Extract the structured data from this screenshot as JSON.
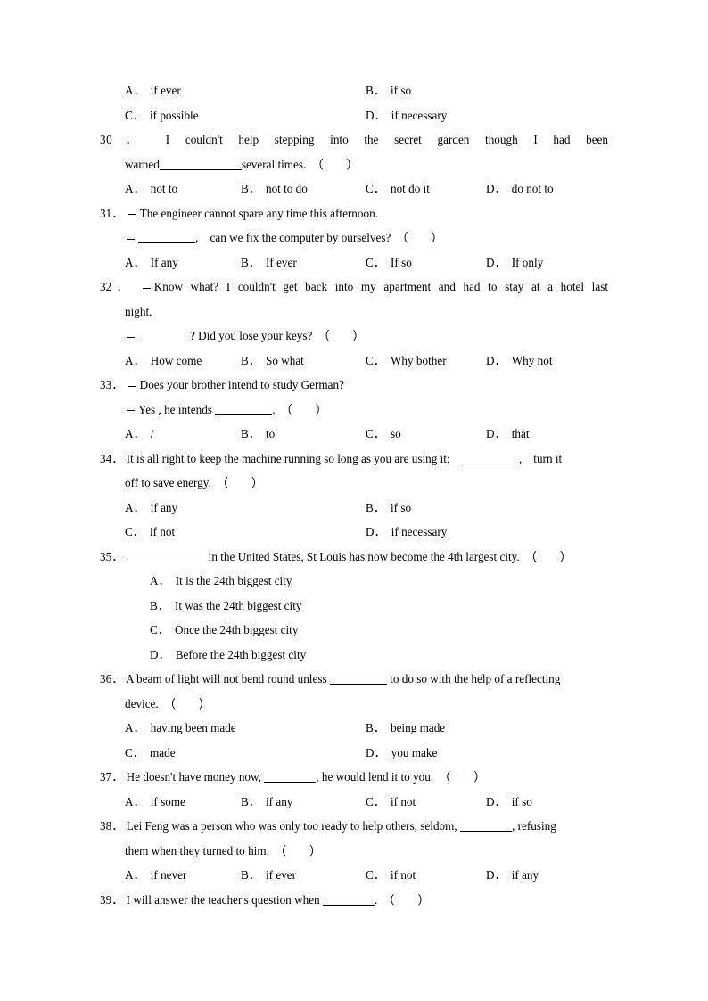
{
  "document": {
    "type": "english-grammar-worksheet",
    "punctuation": {
      "option_separator": "．",
      "paren_open": "（",
      "paren_close": "）",
      "dash": "－"
    }
  },
  "q29_options": {
    "a_label": "A",
    "a_text": "if ever",
    "b_label": "B",
    "b_text": "if so",
    "c_label": "C",
    "c_text": "if possible",
    "d_label": "D",
    "d_text": "if necessary"
  },
  "q30": {
    "number": "30",
    "stem_line1": "I couldn't help stepping into the secret garden though I had been",
    "stem_line2_pre": "warned",
    "stem_line2_post": "several times.",
    "options": {
      "a_label": "A",
      "a_text": "not to",
      "b_label": "B",
      "b_text": "not to do",
      "c_label": "C",
      "c_text": "not do it",
      "d_label": "D",
      "d_text": "do not to"
    }
  },
  "q31": {
    "number": "31",
    "line1": "The engineer cannot spare any time this afternoon.",
    "line2_post": ",　can we fix the computer by ourselves?",
    "options": {
      "a_label": "A",
      "a_text": "If any",
      "b_label": "B",
      "b_text": "If ever",
      "c_label": "C",
      "c_text": "If so",
      "d_label": "D",
      "d_text": "If only"
    }
  },
  "q32": {
    "number": "32",
    "line1": "Know what?  I couldn't get back into my apartment and had to stay at a hotel last",
    "line1_cont": "night.",
    "line2_post": "?  Did you lose your keys?",
    "options": {
      "a_label": "A",
      "a_text": "How come",
      "b_label": "B",
      "b_text": "So what",
      "c_label": "C",
      "c_text": "Why bother",
      "d_label": "D",
      "d_text": "Why not"
    }
  },
  "q33": {
    "number": "33",
    "line1": "Does your brother intend to study German?",
    "line2_pre": "Yes , he intends",
    "line2_post": ".",
    "options": {
      "a_label": "A",
      "a_text": "/",
      "b_label": "B",
      "b_text": "to",
      "c_label": "C",
      "c_text": "so",
      "d_label": "D",
      "d_text": "that"
    }
  },
  "q34": {
    "number": "34",
    "stem_line1": "It is all right to keep the machine running so long as you are using it;",
    "stem_line1_post": ",　turn it",
    "stem_line2": "off to save energy.",
    "options": {
      "a_label": "A",
      "a_text": "if any",
      "b_label": "B",
      "b_text": "if so",
      "c_label": "C",
      "c_text": "if not",
      "d_label": "D",
      "d_text": "if necessary"
    }
  },
  "q35": {
    "number": "35",
    "stem_post": "in the United States, St Louis has now become the 4th largest city.",
    "options": {
      "a_label": "A",
      "a_text": "It is the 24th biggest city",
      "b_label": "B",
      "b_text": "It was the 24th biggest city",
      "c_label": "C",
      "c_text": "Once the 24th biggest city",
      "d_label": "D",
      "d_text": "Before the 24th biggest city"
    }
  },
  "q36": {
    "number": "36",
    "stem_pre": "A beam of light will not bend round unless",
    "stem_post": "to do so with the help of a reflecting",
    "stem_line2": "device.",
    "options": {
      "a_label": "A",
      "a_text": "having been made",
      "b_label": "B",
      "b_text": "being made",
      "c_label": "C",
      "c_text": "made",
      "d_label": "D",
      "d_text": "you make"
    }
  },
  "q37": {
    "number": "37",
    "stem_pre": "He doesn't have money now,",
    "stem_post": ", he would lend it to you.",
    "options": {
      "a_label": "A",
      "a_text": "if some",
      "b_label": "B",
      "b_text": "if any",
      "c_label": "C",
      "c_text": "if not",
      "d_label": "D",
      "d_text": "if so"
    }
  },
  "q38": {
    "number": "38",
    "stem_pre": "Lei Feng was a person who was only too ready to help others, seldom,",
    "stem_post": ", refusing",
    "stem_line2": "them when they turned to him.",
    "options": {
      "a_label": "A",
      "a_text": "if never",
      "b_label": "B",
      "b_text": "if ever",
      "c_label": "C",
      "c_text": "if not",
      "d_label": "D",
      "d_text": "if any"
    }
  },
  "q39": {
    "number": "39",
    "stem_pre": "I will answer the teacher's question when",
    "stem_post": "."
  }
}
